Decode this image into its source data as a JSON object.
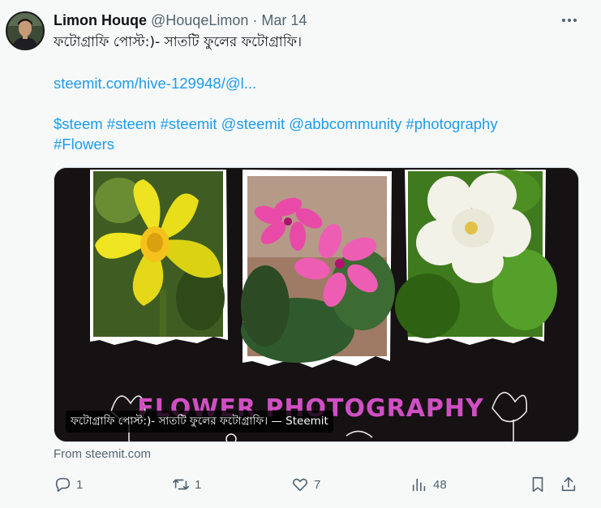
{
  "author": {
    "name": "Limon Houqe",
    "handle": "@HouqeLimon",
    "separator": "·",
    "date": "Mar 14"
  },
  "tweet": {
    "text": "ফটোগ্রাফি পোস্ট:)- সাতটি ফুলের ফটোগ্রাফি।",
    "link": "steemit.com/hive-129948/@l...",
    "hashtags_line1": "$steem #steem #steemit @steemit @abbcommunity #photography",
    "hashtags_line2": "#Flowers"
  },
  "card": {
    "banner_text": "FLOWER PHOTOGRAPHY",
    "caption": "ফটোগ্রাফি পোস্ট:)- সাতটি ফুলের ফটোগ্রাফি। — Steemit",
    "source": "From steemit.com"
  },
  "actions": {
    "replies": "1",
    "retweets": "1",
    "likes": "7",
    "views": "48"
  },
  "icons": [
    "more-icon",
    "reply-icon",
    "retweet-icon",
    "like-icon",
    "views-icon",
    "bookmark-icon",
    "share-icon"
  ],
  "colors": {
    "link": "#1d9bf0",
    "muted": "#536471",
    "banner": "#d04fc4"
  }
}
